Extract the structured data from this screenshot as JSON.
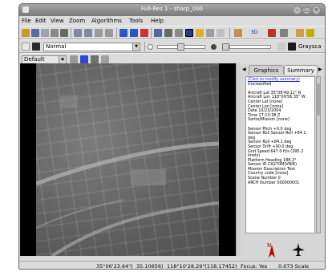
{
  "window": {
    "title": "Full-Res 1 - sharp_000"
  },
  "menubar": {
    "items": [
      "File",
      "Edit",
      "View",
      "Zoom",
      "Algorithms",
      "Tools",
      "Help"
    ]
  },
  "toolbar2": {
    "mode_value": "Normal",
    "grayscale_label": "Graysca"
  },
  "toolbar3": {
    "preset_value": "Default"
  },
  "panel": {
    "tabs": [
      "Graphics",
      "Summary"
    ],
    "active_tab": "Summary",
    "lines": [
      "(Click to modify summary)",
      "Unclassified",
      "",
      "Aircraft Lat 35°08'49.11\" N",
      "Aircraft Lon 118°09'56.35\" W",
      "Center Lat [none]",
      "Center Lon [none]",
      "Date 10/23/2004",
      "Time 17:13:38 Z",
      "Sortie/Mission [none]",
      "",
      "Sensor Pitch +0.0 deg",
      "Sensor Roll Sensor Roll +84.1",
      "deg",
      "Sensor Roll +84.1 deg",
      "Sensor Drift +90.0 deg",
      "Gnd Speed 647.0 ft/s (395.2",
      "knots)",
      "Platform Heading 188.2°",
      "Sensor ID CA270M(VNIR)",
      "Mission Description Text",
      "Country code [none]",
      "Scene Number 0",
      "ARCH Number 000000001"
    ]
  },
  "statusbar": {
    "lat": "35°06'23.64\"(",
    "lat2": "35.10656)",
    "lon": "118°10'28.29\"(118.17452)",
    "focus": "Focus: Yes",
    "scale": "0.073 Scale"
  },
  "colors": {
    "titlebar": "#8a8a8a",
    "chrome": "#dcdcdc",
    "link": "#1a1adb"
  }
}
